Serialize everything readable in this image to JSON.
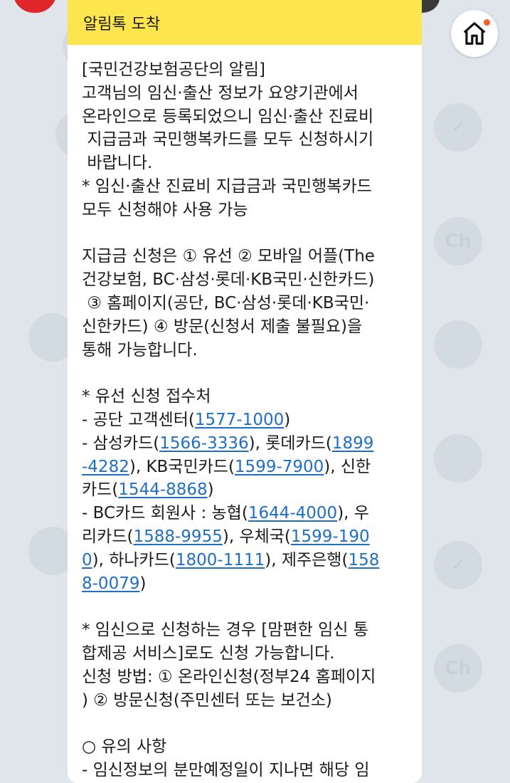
{
  "header": {
    "title": "알림톡 도착"
  },
  "message": {
    "lines": [
      [
        {
          "t": "[국민건강보험공단의 알림]"
        }
      ],
      [
        {
          "t": "고객님의 임신·출산 정보가 요양기관에서"
        }
      ],
      [
        {
          "t": "온라인으로 등록되었으니 임신·출산 진료비"
        }
      ],
      [
        {
          "t": " 지급금과 국민행복카드를 모두 신청하시기"
        }
      ],
      [
        {
          "t": " 바랍니다."
        }
      ],
      [
        {
          "t": "* 임신·출산 진료비 지급금과 국민행복카드"
        }
      ],
      [
        {
          "t": "모두 신청해야 사용 가능"
        }
      ],
      [
        {
          "t": ""
        }
      ],
      [
        {
          "t": "지급금 신청은 ① 유선 ② 모바일 어플(The"
        }
      ],
      [
        {
          "t": "건강보험, BC·삼성·롯데·KB국민·신한카드)"
        }
      ],
      [
        {
          "t": " ③ 홈페이지(공단, BC·삼성·롯데·KB국민·"
        }
      ],
      [
        {
          "t": "신한카드) ④ 방문(신청서 제출 불필요)을"
        }
      ],
      [
        {
          "t": "통해 가능합니다."
        }
      ],
      [
        {
          "t": ""
        }
      ],
      [
        {
          "t": "* 유선 신청 접수처"
        }
      ],
      [
        {
          "t": "- 공단 고객센터("
        },
        {
          "t": "1577-1000",
          "link": true
        },
        {
          "t": ")"
        }
      ],
      [
        {
          "t": "- 삼성카드("
        },
        {
          "t": "1566-3336",
          "link": true
        },
        {
          "t": "), 롯데카드("
        },
        {
          "t": "1899",
          "link": true
        }
      ],
      [
        {
          "t": "-4282",
          "link": true
        },
        {
          "t": "), KB국민카드("
        },
        {
          "t": "1599-7900",
          "link": true
        },
        {
          "t": "), 신한"
        }
      ],
      [
        {
          "t": "카드("
        },
        {
          "t": "1544-8868",
          "link": true
        },
        {
          "t": ")"
        }
      ],
      [
        {
          "t": "- BC카드 회원사 : 농협("
        },
        {
          "t": "1644-4000",
          "link": true
        },
        {
          "t": "), 우"
        }
      ],
      [
        {
          "t": "리카드("
        },
        {
          "t": "1588-9955",
          "link": true
        },
        {
          "t": "), 우체국("
        },
        {
          "t": "1599-190",
          "link": true
        }
      ],
      [
        {
          "t": "0",
          "link": true
        },
        {
          "t": "), 하나카드("
        },
        {
          "t": "1800-1111",
          "link": true
        },
        {
          "t": "), 제주은행("
        },
        {
          "t": "158",
          "link": true
        }
      ],
      [
        {
          "t": "8-0079",
          "link": true
        },
        {
          "t": ")"
        }
      ],
      [
        {
          "t": ""
        }
      ],
      [
        {
          "t": "* 임신으로 신청하는 경우 [맘편한 임신 통"
        }
      ],
      [
        {
          "t": "합제공 서비스]로도 신청 가능합니다."
        }
      ],
      [
        {
          "t": "신청 방법: ① 온라인신청(정부24 홈페이지"
        }
      ],
      [
        {
          "t": ") ② 방문신청(주민센터 또는 보건소)"
        }
      ],
      [
        {
          "t": ""
        }
      ],
      [
        {
          "t": "○ 유의 사항"
        }
      ],
      [
        {
          "t": "- 임신정보의 분만예정일이 지나면 해당 임"
        }
      ]
    ]
  },
  "icons": {
    "home": "home-icon",
    "notification": "notification-dot"
  },
  "colors": {
    "header_bg": "#fce54d",
    "link": "#1f6fc9",
    "background": "#dfe5ea",
    "badge": "#ff5a1f"
  }
}
